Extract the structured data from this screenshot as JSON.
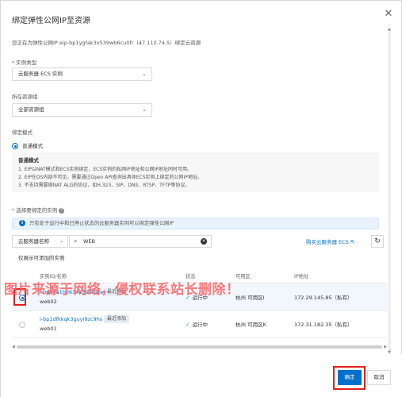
{
  "dialog": {
    "title": "绑定弹性公网IP至资源",
    "close_icon": "close-icon"
  },
  "description": "您正在为弹性公网IP eip-bp1ygfak3x539wb6cu0fr（47.110.74.5）绑定云资源",
  "instance_type": {
    "required_mark": "*",
    "label": "实例类型",
    "value": "云服务器 ECS 实例"
  },
  "resource_group": {
    "label": "所在资源组",
    "value": "全部资源组"
  },
  "bind_mode": {
    "label": "绑定模式",
    "option": "普通模式",
    "note_title": "普通模式",
    "note_lines": [
      "1. EIP以NAT模式和ECS实例绑定，ECS实例的私网IP地址和公网IP地址同时可用。",
      "2. EIP在OS内部不可见，需要通过Open API查询出具体ECS实例上绑定的公网IP地址。",
      "3. 不支持需要做NAT ALG的协议，如H.323、SIP、DNS、RTSP、TFTP等协议。"
    ]
  },
  "select_instance": {
    "required_mark": "*",
    "label": "选择要绑定的实例",
    "help_icon": "help-icon",
    "info_icon": "info-icon",
    "info_text": "只有处于运行中和已停止状态的云服务器实例可以绑定弹性公网IP",
    "search_type": "云服务器名称",
    "search_value": "WEB",
    "buy_link": "购买云服务器 ECS",
    "only_addable": "仅展示可添加的实例"
  },
  "table": {
    "columns": [
      "实例ID/名称",
      "状态",
      "可用区",
      "IP地址"
    ],
    "rows": [
      {
        "id": "i-bp10a1h0634p59ohajw5",
        "name": "web02",
        "badge": "最近添加",
        "status": "运行中",
        "zone": "杭州 可用区I",
        "ip": "172.29.145.85（私有）",
        "selected": true
      },
      {
        "id": "i-bp1dfkkqk3guyi9zc9hs",
        "name": "web01",
        "badge": "最近添加",
        "status": "运行中",
        "zone": "杭州 可用区K",
        "ip": "172.31.182.35（私有）",
        "selected": false
      }
    ]
  },
  "watermark": "图片来源于网络，侵权联系站长删除！",
  "footer": {
    "ok_label": "确定",
    "cancel_label": "取消"
  },
  "colors": {
    "accent": "#0070cc",
    "highlight_box": "#e02020",
    "watermark": "#ff5c5c",
    "status_ok": "#1aa06d"
  }
}
